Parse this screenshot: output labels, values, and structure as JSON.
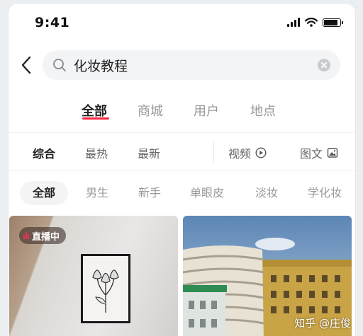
{
  "status_bar": {
    "time": "9:41",
    "battery_level": 0.9
  },
  "search": {
    "query": "化妆教程",
    "placeholder": ""
  },
  "primary_tabs": [
    {
      "label": "全部",
      "active": true
    },
    {
      "label": "商城",
      "active": false
    },
    {
      "label": "用户",
      "active": false
    },
    {
      "label": "地点",
      "active": false
    }
  ],
  "filters": [
    {
      "label": "综合",
      "active": true
    },
    {
      "label": "最热",
      "active": false
    },
    {
      "label": "最新",
      "active": false
    },
    {
      "label": "视频",
      "icon": "play-circle-icon"
    },
    {
      "label": "图文",
      "icon": "image-icon"
    }
  ],
  "chips": [
    {
      "label": "全部",
      "active": true
    },
    {
      "label": "男生"
    },
    {
      "label": "新手"
    },
    {
      "label": "单眼皮"
    },
    {
      "label": "淡妆"
    },
    {
      "label": "学化妆"
    }
  ],
  "cards": [
    {
      "badge": "直播中"
    },
    {
      "badge": ""
    }
  ],
  "watermark": "知乎 @庄俊",
  "colors": {
    "accent": "#ff2442",
    "live": "#ff2d55"
  }
}
